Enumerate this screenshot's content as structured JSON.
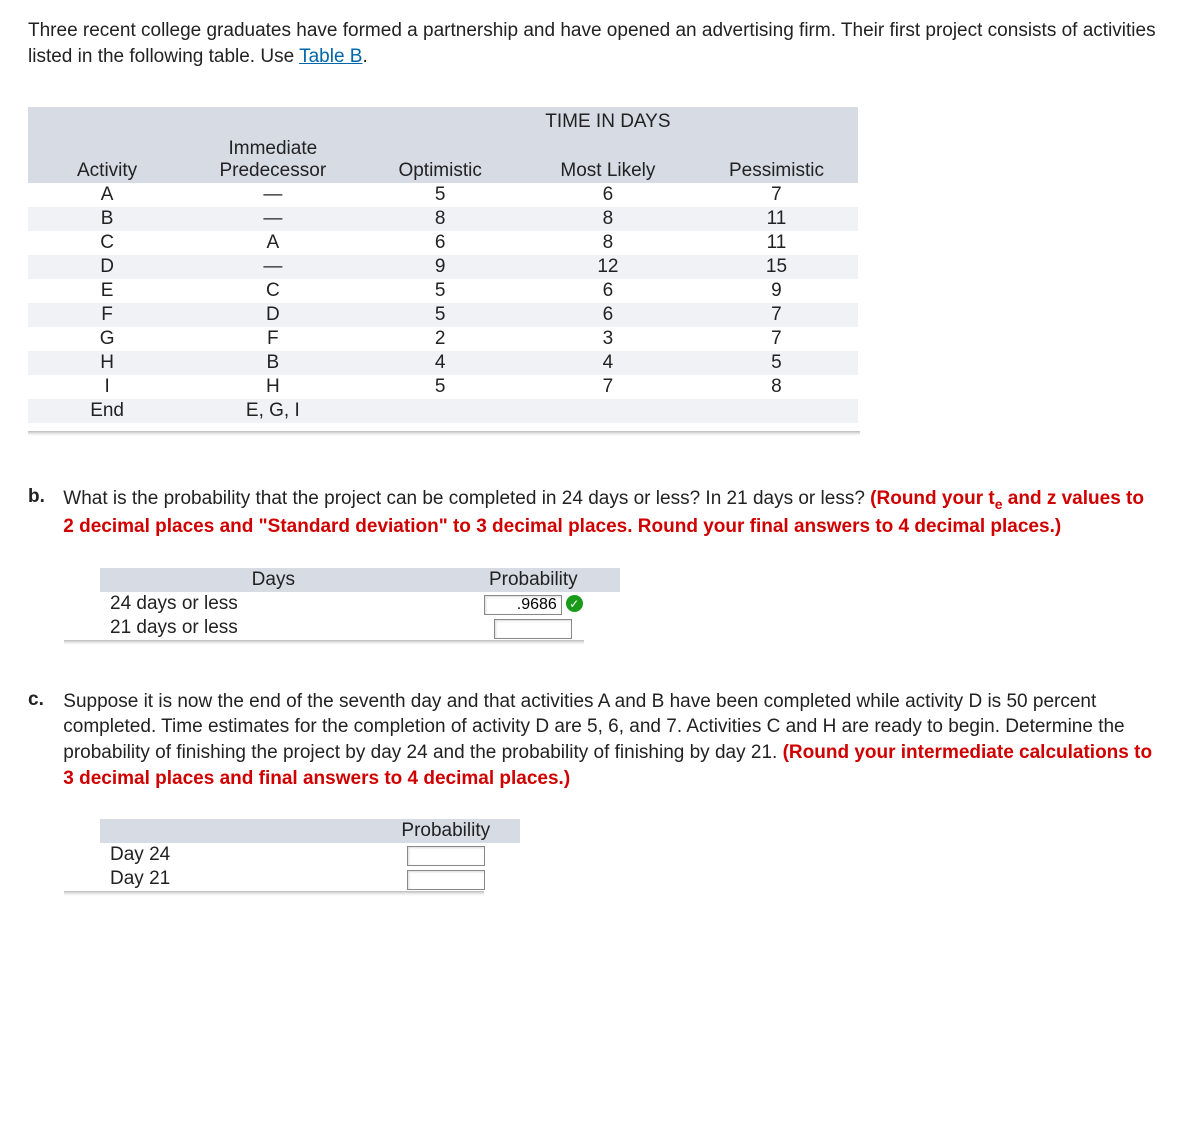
{
  "intro": {
    "text_before_link": "Three recent college graduates have formed a partnership and have opened an advertising firm. Their first project consists of activities listed in the following table. Use ",
    "link_text": "Table B",
    "text_after_link": "."
  },
  "main_table": {
    "super_header": "TIME IN DAYS",
    "headers": {
      "activity": "Activity",
      "pred_line1": "Immediate",
      "pred_line2": "Predecessor",
      "opt": "Optimistic",
      "ml": "Most Likely",
      "pes": "Pessimistic"
    },
    "rows": [
      {
        "activity": "A",
        "pred": "—",
        "opt": "5",
        "ml": "6",
        "pes": "7"
      },
      {
        "activity": "B",
        "pred": "—",
        "opt": "8",
        "ml": "8",
        "pes": "11"
      },
      {
        "activity": "C",
        "pred": "A",
        "opt": "6",
        "ml": "8",
        "pes": "11"
      },
      {
        "activity": "D",
        "pred": "—",
        "opt": "9",
        "ml": "12",
        "pes": "15"
      },
      {
        "activity": "E",
        "pred": "C",
        "opt": "5",
        "ml": "6",
        "pes": "9"
      },
      {
        "activity": "F",
        "pred": "D",
        "opt": "5",
        "ml": "6",
        "pes": "7"
      },
      {
        "activity": "G",
        "pred": "F",
        "opt": "2",
        "ml": "3",
        "pes": "7"
      },
      {
        "activity": "H",
        "pred": "B",
        "opt": "4",
        "ml": "4",
        "pes": "5"
      },
      {
        "activity": "I",
        "pred": "H",
        "opt": "5",
        "ml": "7",
        "pes": "8"
      },
      {
        "activity": "End",
        "pred": "E, G, I",
        "opt": "",
        "ml": "",
        "pes": ""
      }
    ]
  },
  "question_b": {
    "letter": "b.",
    "text": "What is the probability that the project can be completed in 24 days or less? In 21 days or less? ",
    "red_part1": "(Round your t",
    "red_sub": "e",
    "red_part2": " and z values to 2 decimal places and \"Standard deviation\" to 3 decimal places. Round your final answers to 4 decimal places.)",
    "table": {
      "h1": "Days",
      "h2": "Probability",
      "rows": [
        {
          "label": "24 days or less",
          "value": ".9686",
          "correct": true
        },
        {
          "label": "21 days or less",
          "value": "",
          "correct": false
        }
      ]
    }
  },
  "question_c": {
    "letter": "c.",
    "text": "Suppose it is now the end of the seventh day and that activities A and B have been completed while activity D is 50 percent completed. Time estimates for the completion of activity D are 5, 6, and 7. Activities C and H are ready to begin. Determine the probability of finishing the project by day 24 and the probability of finishing by day 21. ",
    "red": "(Round your intermediate calculations to 3 decimal places and final answers to 4 decimal places.)",
    "table": {
      "h2": "Probability",
      "rows": [
        {
          "label": "Day 24",
          "value": ""
        },
        {
          "label": "Day 21",
          "value": ""
        }
      ]
    }
  }
}
